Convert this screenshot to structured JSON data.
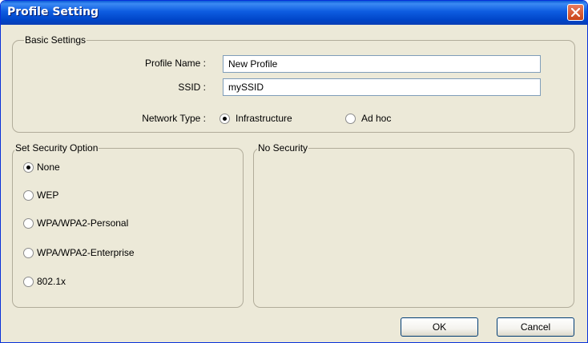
{
  "window": {
    "title": "Profile Setting"
  },
  "basic_settings": {
    "legend": "Basic Settings",
    "profile_name_label": "Profile Name :",
    "profile_name_value": "New Profile",
    "ssid_label": "SSID :",
    "ssid_value": "mySSID",
    "network_type_label": "Network Type :",
    "network_types": [
      {
        "label": "Infrastructure",
        "selected": true
      },
      {
        "label": "Ad hoc",
        "selected": false
      }
    ]
  },
  "security": {
    "legend": "Set Security Option",
    "options": [
      {
        "label": "None",
        "selected": true
      },
      {
        "label": "WEP",
        "selected": false
      },
      {
        "label": "WPA/WPA2-Personal",
        "selected": false
      },
      {
        "label": "WPA/WPA2-Enterprise",
        "selected": false
      },
      {
        "label": "802.1x",
        "selected": false
      }
    ]
  },
  "detail_panel": {
    "legend": "No Security"
  },
  "buttons": {
    "ok": "OK",
    "cancel": "Cancel"
  },
  "colors": {
    "titlebar": "#0a5bd6",
    "window_bg": "#ece9d8",
    "close_button": "#d8552c"
  }
}
